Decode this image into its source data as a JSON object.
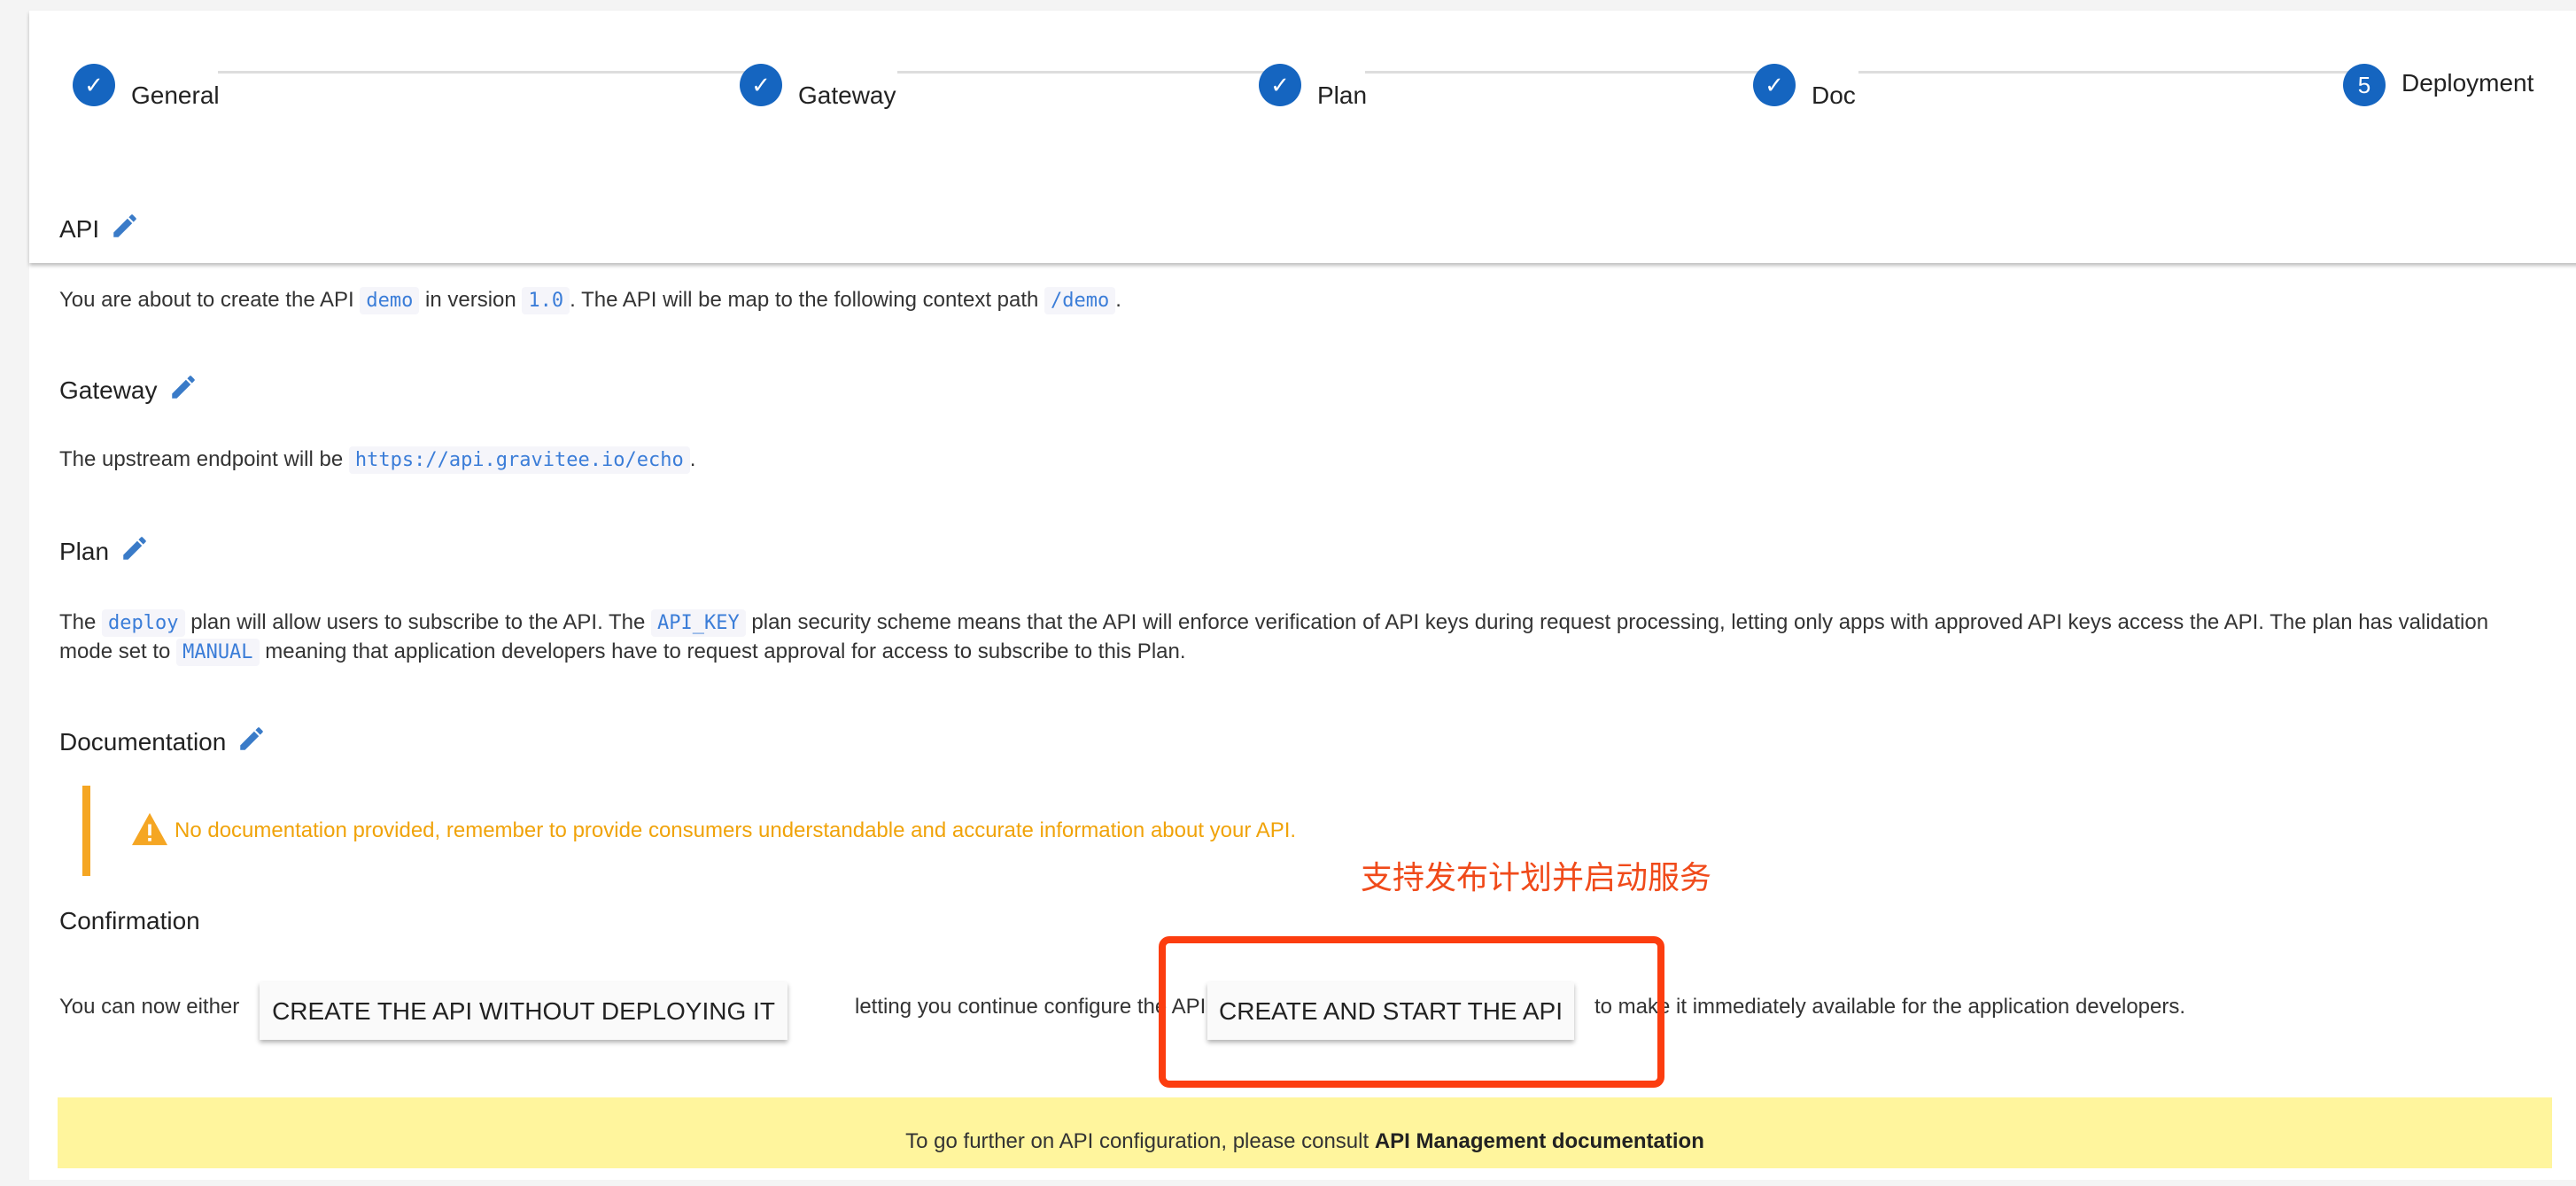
{
  "stepper": {
    "steps": [
      {
        "label": "General",
        "state": "done",
        "icon": "check-icon"
      },
      {
        "label": "Gateway",
        "state": "done",
        "icon": "check-icon"
      },
      {
        "label": "Plan",
        "state": "done",
        "icon": "check-icon"
      },
      {
        "label": "Doc",
        "state": "done",
        "icon": "check-icon"
      },
      {
        "label": "Deployment",
        "state": "current",
        "number": "5"
      }
    ],
    "accent": "#1565c0"
  },
  "api": {
    "heading": "API",
    "t1": "You are about to create the API",
    "name": "demo",
    "t2": "in version",
    "version": "1.0",
    "t3": ". The API will be map to the following context path",
    "path": "/demo",
    "t4": "."
  },
  "gateway": {
    "heading": "Gateway",
    "t1": "The upstream endpoint will be",
    "endpoint": "https://api.gravitee.io/echo",
    "t2": "."
  },
  "plan": {
    "heading": "Plan",
    "t1": "The",
    "name": "deploy",
    "t2": "plan will allow users to subscribe to the API. The",
    "security": "API_KEY",
    "t3": "plan security scheme means that the API will enforce verification of API keys during request processing, letting only apps with approved API keys access the API. The plan has validation",
    "t4": "mode set to",
    "validation": "MANUAL",
    "t5": "meaning that application developers have to request approval for access to subscribe to this Plan."
  },
  "documentation": {
    "heading": "Documentation",
    "warning": "No documentation provided, remember to provide consumers understandable and accurate information about your API.",
    "warning_color": "#f5a623"
  },
  "annotation": {
    "text": "支持发布计划并启动服务",
    "color": "#fc3d0f"
  },
  "confirmation": {
    "heading": "Confirmation",
    "t1": "You can now either",
    "create_button": "CREATE THE API WITHOUT DEPLOYING IT",
    "t2": "letting you continue configure the API or",
    "start_button": "CREATE AND START THE API",
    "t3": "to make it immediately available for the application developers."
  },
  "banner": {
    "text": "To go further on API configuration, please consult",
    "link": "API Management documentation",
    "color": "#fff59d"
  }
}
